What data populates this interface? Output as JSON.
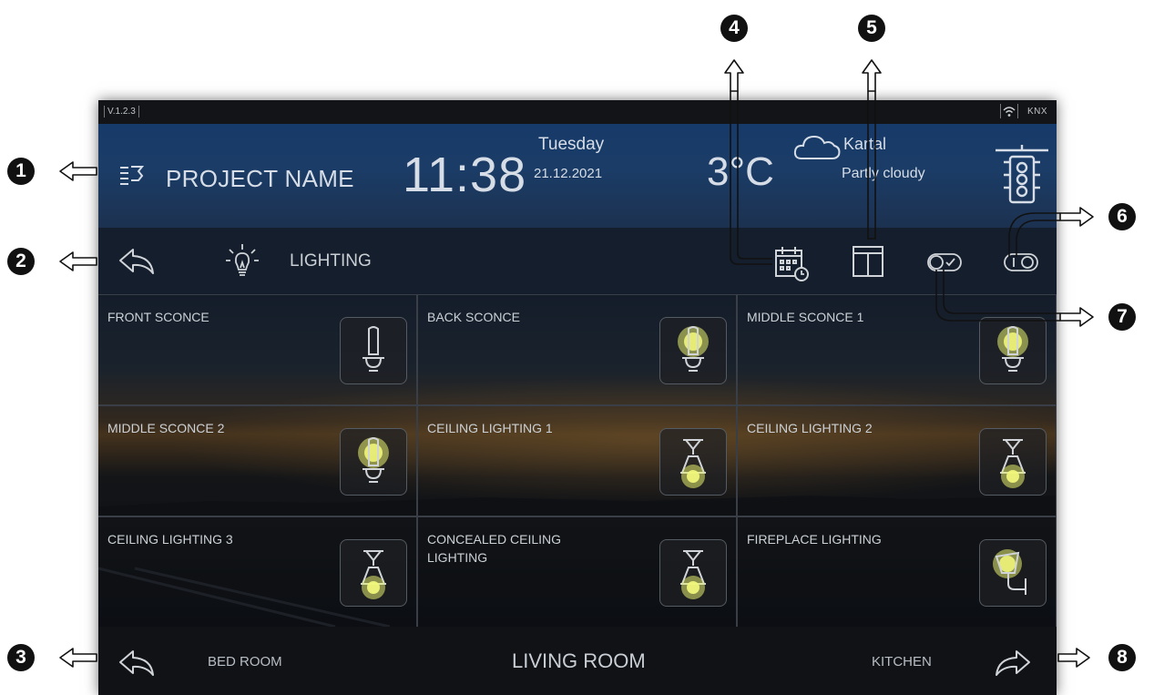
{
  "status_bar": {
    "version": "V.1.2.3",
    "connection": "KNX",
    "wifi_icon": "wifi-icon"
  },
  "header": {
    "project_name": "PROJECT NAME",
    "project_icon": "project-icon",
    "time": "11:38",
    "day": "Tuesday",
    "date": "21.12.2021",
    "temperature": "3°C",
    "weather_icon": "cloud-icon",
    "location": "Kartal",
    "condition": "Partly cloudy",
    "traffic_icon": "traffic-light-icon"
  },
  "toolbar": {
    "title": "LIGHTING",
    "icons": [
      "back-arrow-icon",
      "bulb-icon",
      "calendar-clock-icon",
      "layout-icon",
      "toggle-check-icon",
      "toggle-on-off-icon"
    ]
  },
  "tiles": [
    {
      "name": "FRONT SCONCE",
      "icon": "sconce-icon",
      "on": false
    },
    {
      "name": "BACK SCONCE",
      "icon": "sconce-icon",
      "on": true
    },
    {
      "name": "MIDDLE SCONCE 1",
      "icon": "sconce-icon",
      "on": true
    },
    {
      "name": "MIDDLE SCONCE 2",
      "icon": "sconce-icon",
      "on": true
    },
    {
      "name": "CEILING LIGHTING 1",
      "icon": "ceiling-lamp-icon",
      "on": true
    },
    {
      "name": "CEILING LIGHTING 2",
      "icon": "ceiling-lamp-icon",
      "on": true
    },
    {
      "name": "CEILING LIGHTING 3",
      "icon": "ceiling-lamp-icon",
      "on": true
    },
    {
      "name": "CONCEALED CEILING LIGHTING",
      "icon": "ceiling-lamp-icon",
      "on": true
    },
    {
      "name": "FIREPLACE LIGHTING",
      "icon": "wall-lamp-icon",
      "on": true
    }
  ],
  "bottom_bar": {
    "previous_room": "BED ROOM",
    "current_room": "LIVING ROOM",
    "next_room": "KITCHEN"
  },
  "callouts": [
    "1",
    "2",
    "3",
    "4",
    "5",
    "6",
    "7",
    "8"
  ],
  "colors": {
    "glow": "#e8f070",
    "line": "#d0d4d8",
    "callout_bg": "#111111"
  }
}
